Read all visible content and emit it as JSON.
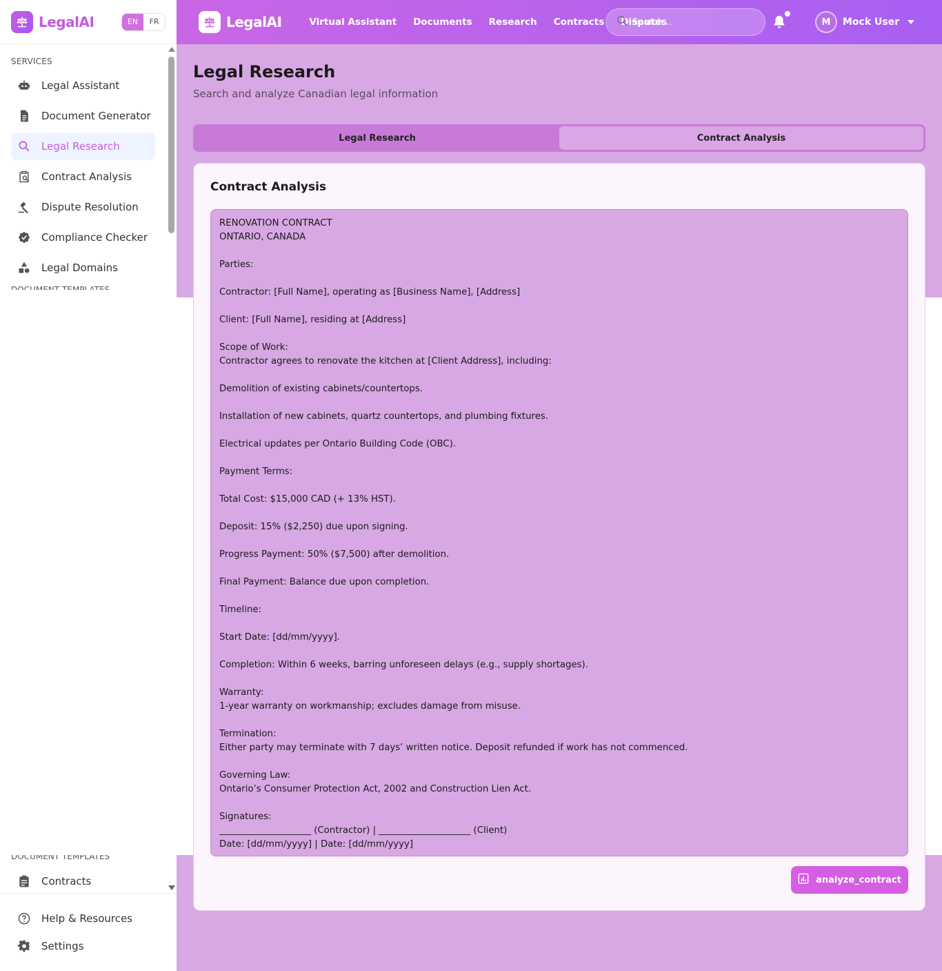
{
  "brand": {
    "name": "LegalAI"
  },
  "language": {
    "en": "EN",
    "fr": "FR"
  },
  "sidebar": {
    "services_heading": "SERVICES",
    "items": [
      {
        "label": "Legal Assistant",
        "icon": "robot-icon"
      },
      {
        "label": "Document Generator",
        "icon": "document-icon"
      },
      {
        "label": "Legal Research",
        "icon": "search-icon",
        "active": true
      },
      {
        "label": "Contract Analysis",
        "icon": "clipboard-search-icon"
      },
      {
        "label": "Dispute Resolution",
        "icon": "gavel-icon"
      },
      {
        "label": "Compliance Checker",
        "icon": "verified-badge-icon"
      },
      {
        "label": "Legal Domains",
        "icon": "shapes-icon"
      }
    ],
    "templates_heading": "DOCUMENT TEMPLATES",
    "template_items": [
      {
        "label": "Contracts",
        "icon": "contract-icon"
      }
    ],
    "bottom_items": [
      {
        "label": "Help & Resources",
        "icon": "help-icon"
      },
      {
        "label": "Settings",
        "icon": "gear-icon"
      }
    ]
  },
  "topbar": {
    "nav": [
      "Virtual Assistant",
      "Documents",
      "Research",
      "Contracts",
      "Disputes"
    ],
    "search_placeholder": "Search...",
    "user_initial": "M",
    "user_name": "Mock User"
  },
  "main": {
    "title": "Legal Research",
    "subtitle": "Search and analyze Canadian legal information",
    "tabs": [
      "Legal Research",
      "Contract Analysis"
    ],
    "selected_tab": "Contract Analysis",
    "card_title": "Contract Analysis",
    "contract_text": "RENOVATION CONTRACT\nONTARIO, CANADA\n\nParties:\n\nContractor: [Full Name], operating as [Business Name], [Address]\n\nClient: [Full Name], residing at [Address]\n\nScope of Work:\nContractor agrees to renovate the kitchen at [Client Address], including:\n\nDemolition of existing cabinets/countertops.\n\nInstallation of new cabinets, quartz countertops, and plumbing fixtures.\n\nElectrical updates per Ontario Building Code (OBC).\n\nPayment Terms:\n\nTotal Cost: $15,000 CAD (+ 13% HST).\n\nDeposit: 15% ($2,250) due upon signing.\n\nProgress Payment: 50% ($7,500) after demolition.\n\nFinal Payment: Balance due upon completion.\n\nTimeline:\n\nStart Date: [dd/mm/yyyy].\n\nCompletion: Within 6 weeks, barring unforeseen delays (e.g., supply shortages).\n\nWarranty:\n1-year warranty on workmanship; excludes damage from misuse.\n\nTermination:\nEither party may terminate with 7 days’ written notice. Deposit refunded if work has not commenced.\n\nGoverning Law:\nOntario’s Consumer Protection Act, 2002 and Construction Lien Act.\n\nSignatures:\n____________________ (Contractor) | ____________________ (Client)\nDate: [dd/mm/yyyy] | Date: [dd/mm/yyyy]",
    "analyze_label": "analyze_contract"
  }
}
